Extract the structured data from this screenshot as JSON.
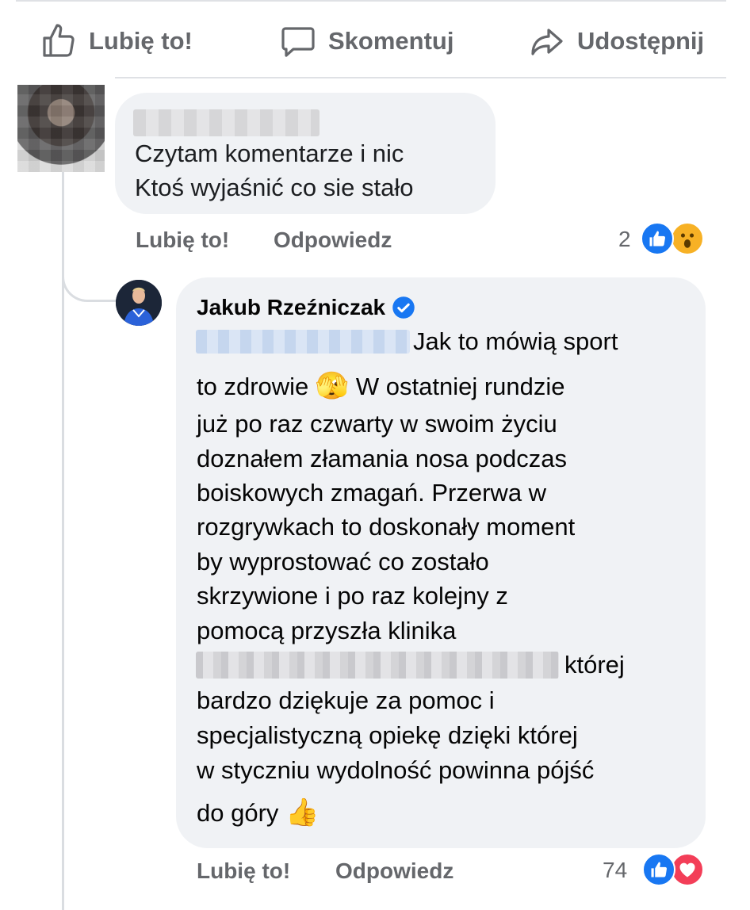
{
  "actions": {
    "like": "Lubię to!",
    "comment": "Skomentuj",
    "share": "Udostępnij"
  },
  "comment1": {
    "text": "Czytam komentarze i nic\nKtoś wyjaśnić co sie stało",
    "like_action": "Lubię to!",
    "reply_action": "Odpowiedz",
    "reaction_count": "2",
    "reaction_icons": [
      "like-icon",
      "wow-icon"
    ]
  },
  "comment2": {
    "author": "Jakub Rzeźniczak",
    "verified_icon": "verified-badge-icon",
    "lines": [
      "Jak to mówią sport",
      "to zdrowie",
      "W ostatniej rundzie",
      "już po raz czwarty w swoim życiu",
      "doznałem złamania nosa podczas",
      "boiskowych zmagań. Przerwa w",
      "rozgrywkach to doskonały moment",
      "by wyprostować co zostało",
      "skrzywione i po raz kolejny z",
      "pomocą przyszła klinika",
      "której",
      "bardzo dziękuje za pomoc i",
      "specjalistyczną opiekę dzięki której",
      "w styczniu wydolność powinna pójść",
      "do góry"
    ],
    "emoji_face": "🫣",
    "emoji_thumb": "👍",
    "like_action": "Lubię to!",
    "reply_action": "Odpowiedz",
    "reaction_count": "74",
    "reaction_icons": [
      "like-icon",
      "love-icon"
    ]
  },
  "colors": {
    "meta_text": "#65676b",
    "bubble_bg": "#f0f2f5",
    "like_blue": "#1877f2",
    "love_red": "#f33e58",
    "wow_yellow": "#f7b125"
  }
}
